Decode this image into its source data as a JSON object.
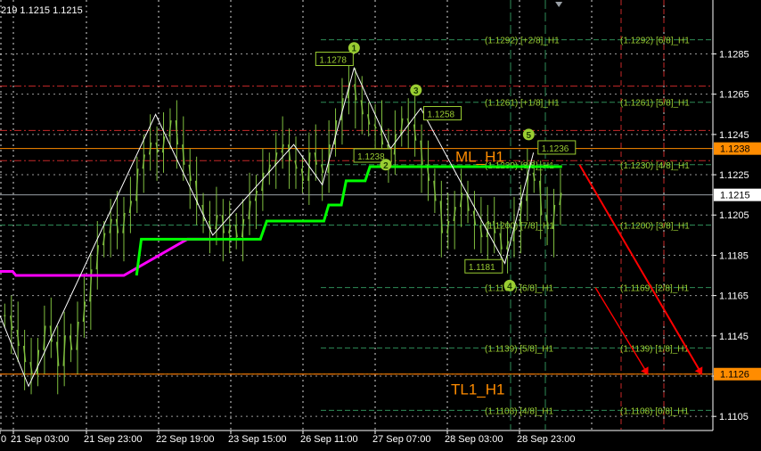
{
  "header": {
    "text": "219 1.1215 1.1215"
  },
  "colors": {
    "background": "#000000",
    "grid": "#ffffff",
    "candles": "#7fbf3f",
    "zigzag": "#ffffff",
    "trail_green": "#00ff00",
    "trail_magenta": "#ff00ff",
    "murrey_red": "#c62828",
    "murrey_green": "#2e8b57",
    "level_text": "#9acd32",
    "orange": "#ff8c00",
    "arrow": "#ff0000",
    "label_box": "#9acd32"
  },
  "chart_data": {
    "type": "line",
    "title": "",
    "ylim": [
      1.1098,
      1.131
    ],
    "y_ticks": [
      "1.1285",
      "1.1265",
      "1.1245",
      "1.1225",
      "1.1205",
      "1.1185",
      "1.1165",
      "1.1145",
      "1.1125",
      "1.1105"
    ],
    "x_ticks": [
      "0",
      "21 Sep 03:00",
      "21 Sep 23:00",
      "22 Sep 19:00",
      "23 Sep 15:00",
      "26 Sep 11:00",
      "27 Sep 07:00",
      "28 Sep 03:00",
      "28 Sep 23:00"
    ],
    "price_tags": [
      {
        "value": "1.1238",
        "style": "orange"
      },
      {
        "value": "1.1215",
        "style": "white"
      },
      {
        "value": "1.1126",
        "style": "orange"
      }
    ],
    "murrey_left": [
      {
        "price": 1.1292,
        "label": "(1.1292) [+2/8]_H1",
        "style": "green"
      },
      {
        "price": 1.1261,
        "label": "(1.1261) [+1/8]_H1",
        "style": "green"
      },
      {
        "price": 1.123,
        "label": "(1.1230) [8/8]_H1",
        "style": "green"
      },
      {
        "price": 1.12,
        "label": "(1.1200) [7/8]_H1",
        "style": "green"
      },
      {
        "price": 1.1169,
        "label": "(1.1169) [6/8]_H1",
        "style": "green"
      },
      {
        "price": 1.1139,
        "label": "(1.1139) [5/8]_H1",
        "style": "green"
      },
      {
        "price": 1.1108,
        "label": "(1.1108) [4/8]_H1",
        "style": "green"
      }
    ],
    "murrey_right": [
      {
        "price": 1.1292,
        "label": "(1.1292) [6/8]_H1"
      },
      {
        "price": 1.1261,
        "label": "(1.1261) [5/8]_H1"
      },
      {
        "price": 1.123,
        "label": "(1.1230) [4/8]_H1"
      },
      {
        "price": 1.12,
        "label": "(1.1200) [3/8]_H1"
      },
      {
        "price": 1.1169,
        "label": "(1.1169) [2/8]_H1"
      },
      {
        "price": 1.1139,
        "label": "(1.1139) [1/8]_H1"
      },
      {
        "price": 1.1108,
        "label": "(1.1108) [0/8]_H1"
      }
    ],
    "red_levels": [
      1.1269,
      1.1247,
      1.1232,
      1.1126
    ],
    "orange_levels": [
      1.1238,
      1.1126
    ],
    "white_level": 1.1215,
    "ml_label": "ML_H1",
    "tl_label": "TL1_H1",
    "zigzag": [
      {
        "t": 0.0,
        "p": 1.1155
      },
      {
        "t": 1.8,
        "p": 1.112
      },
      {
        "t": 9.8,
        "p": 1.1255
      },
      {
        "t": 13.4,
        "p": 1.1195
      },
      {
        "t": 18.5,
        "p": 1.124
      },
      {
        "t": 20.3,
        "p": 1.122
      },
      {
        "t": 22.3,
        "p": 1.1278
      },
      {
        "t": 24.6,
        "p": 1.1238
      },
      {
        "t": 26.5,
        "p": 1.1258
      },
      {
        "t": 31.8,
        "p": 1.1181
      },
      {
        "t": 33.6,
        "p": 1.1236
      }
    ],
    "trail_magenta": [
      {
        "t": 0.0,
        "p": 1.1177
      },
      {
        "t": 0.8,
        "p": 1.1177
      },
      {
        "t": 1.0,
        "p": 1.1175
      },
      {
        "t": 7.8,
        "p": 1.1175
      },
      {
        "t": 11.8,
        "p": 1.1193
      },
      {
        "t": 13.4,
        "p": 1.1193
      }
    ],
    "trail_green": [
      {
        "t": 8.6,
        "p": 1.1175
      },
      {
        "t": 8.9,
        "p": 1.1193
      },
      {
        "t": 16.4,
        "p": 1.1193
      },
      {
        "t": 16.8,
        "p": 1.1202
      },
      {
        "t": 20.4,
        "p": 1.1202
      },
      {
        "t": 20.7,
        "p": 1.121
      },
      {
        "t": 21.5,
        "p": 1.121
      },
      {
        "t": 21.8,
        "p": 1.1222
      },
      {
        "t": 23.0,
        "p": 1.1222
      },
      {
        "t": 23.3,
        "p": 1.1229
      },
      {
        "t": 35.4,
        "p": 1.1229
      }
    ],
    "candle_series": [
      1.1155,
      1.1148,
      1.114,
      1.1132,
      1.1126,
      1.1138,
      1.115,
      1.1142,
      1.113,
      1.1145,
      1.1138,
      1.1152,
      1.1162,
      1.1178,
      1.119,
      1.1196,
      1.1203,
      1.1196,
      1.1206,
      1.1212,
      1.1228,
      1.1235,
      1.1241,
      1.1236,
      1.1244,
      1.1252,
      1.124,
      1.123,
      1.1222,
      1.121,
      1.1202,
      1.1198,
      1.1205,
      1.1196,
      1.12,
      1.1194,
      1.1203,
      1.1212,
      1.1217,
      1.1226,
      1.123,
      1.1236,
      1.124,
      1.1232,
      1.1228,
      1.1222,
      1.1236,
      1.123,
      1.1226,
      1.124,
      1.1252,
      1.1263,
      1.127,
      1.1262,
      1.1255,
      1.125,
      1.1248,
      1.124,
      1.1235,
      1.1245,
      1.1253,
      1.125,
      1.1242,
      1.123,
      1.1222,
      1.1212,
      1.1196,
      1.1202,
      1.1209,
      1.1216,
      1.1207,
      1.12,
      1.1194,
      1.1202,
      1.1196,
      1.1188,
      1.1192,
      1.12,
      1.1212,
      1.1226,
      1.1222,
      1.1205,
      1.1198,
      1.121,
      1.1216
    ],
    "candle_t_start": 0.3,
    "candle_t_end": 35.3,
    "point_labels": [
      {
        "text": "1.1278",
        "t": 20.0,
        "p": 1.1281
      },
      {
        "text": "1.1238",
        "t": 22.4,
        "p": 1.1233
      },
      {
        "text": "1.1258",
        "t": 26.8,
        "p": 1.1254
      },
      {
        "text": "1.1181",
        "t": 29.4,
        "p": 1.1178
      },
      {
        "text": "1.1236",
        "t": 34.0,
        "p": 1.1237
      }
    ],
    "wave_markers": [
      {
        "text": "1",
        "t": 22.3,
        "p": 1.1288
      },
      {
        "text": "2",
        "t": 24.3,
        "p": 1.123
      },
      {
        "text": "3",
        "t": 26.2,
        "p": 1.1267
      },
      {
        "text": "4",
        "t": 32.1,
        "p": 1.117
      },
      {
        "text": "5",
        "t": 33.3,
        "p": 1.1245
      }
    ],
    "arrows": [
      {
        "from_t": 36.5,
        "from_p": 1.123,
        "to_t": 44.2,
        "to_p": 1.1126
      },
      {
        "from_t": 37.5,
        "from_p": 1.1169,
        "to_t": 40.8,
        "to_p": 1.1126
      }
    ],
    "marker_triangle": {
      "t": 35.2,
      "p": 1.131
    }
  }
}
